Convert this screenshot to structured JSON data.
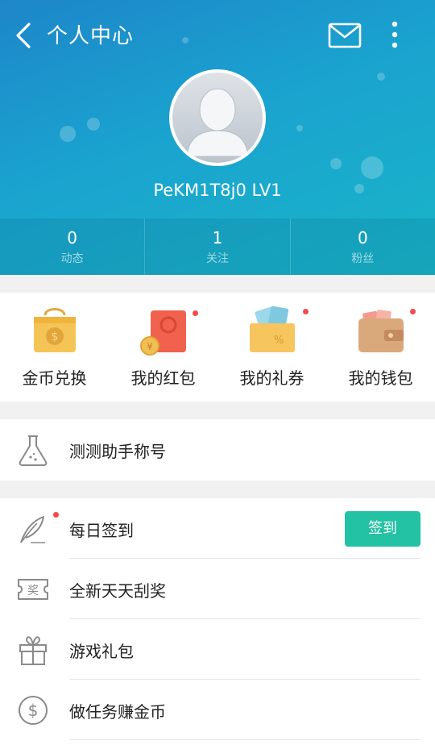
{
  "header": {
    "title": "个人中心",
    "username": "PeKM1T8j0 LV1"
  },
  "stats": [
    {
      "value": "0",
      "label": "动态"
    },
    {
      "value": "1",
      "label": "关注"
    },
    {
      "value": "0",
      "label": "粉丝"
    }
  ],
  "quick_items": [
    {
      "label": "金币兑换",
      "icon": "coin-bag-icon",
      "dot": false
    },
    {
      "label": "我的红包",
      "icon": "red-envelope-icon",
      "dot": true
    },
    {
      "label": "我的礼券",
      "icon": "coupon-icon",
      "dot": true
    },
    {
      "label": "我的钱包",
      "icon": "wallet-icon",
      "dot": true
    }
  ],
  "list_section_1": [
    {
      "label": "测测助手称号",
      "icon": "flask-icon"
    }
  ],
  "list_section_2": [
    {
      "label": "每日签到",
      "icon": "feather-icon",
      "dot": true,
      "button": "签到"
    },
    {
      "label": "全新天天刮奖",
      "icon": "lottery-ticket-icon"
    },
    {
      "label": "游戏礼包",
      "icon": "gift-icon"
    },
    {
      "label": "做任务赚金币",
      "icon": "dollar-coin-icon"
    }
  ],
  "colors": {
    "header_start": "#1d86c9",
    "header_end": "#19b5c8",
    "sign_button": "#23c2a4",
    "red_dot": "#f34a4a"
  }
}
